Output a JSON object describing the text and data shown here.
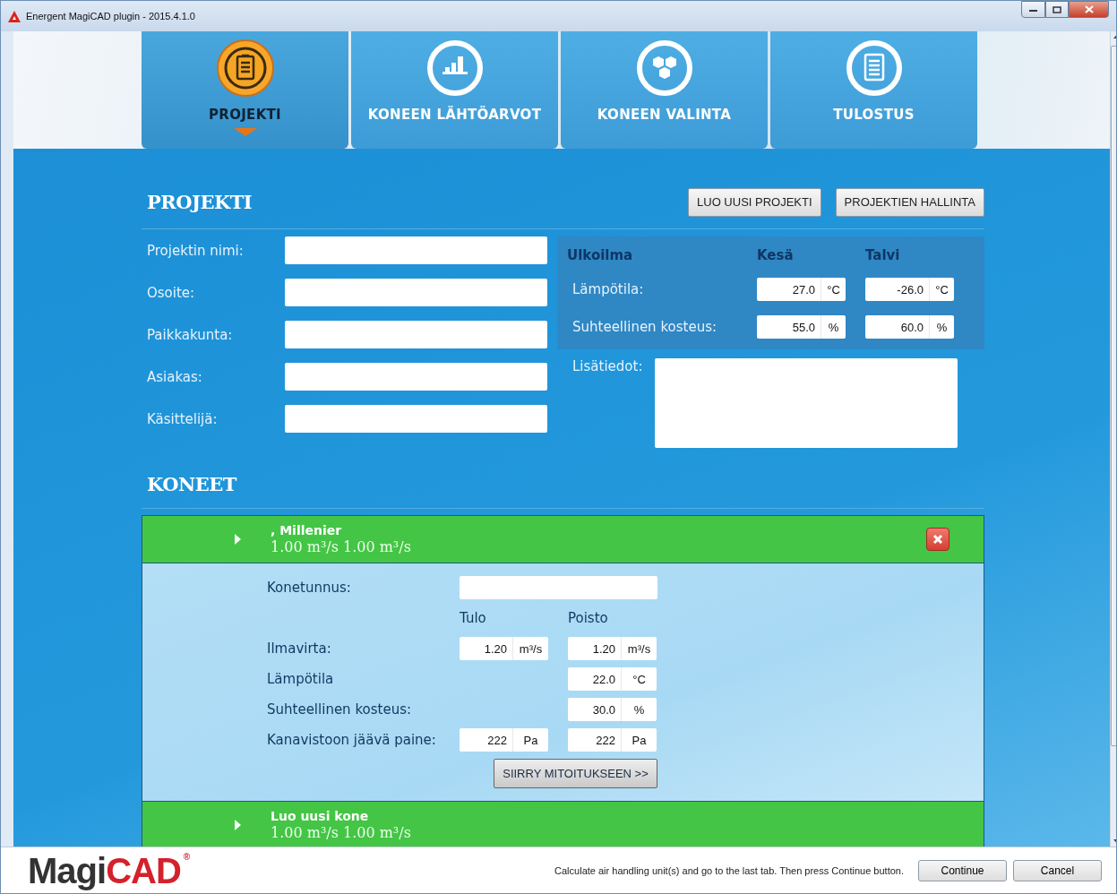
{
  "window": {
    "title": "Energent MagiCAD plugin - 2015.4.1.0"
  },
  "tabs": [
    {
      "label": "PROJEKTI",
      "selected": true
    },
    {
      "label": "KONEEN LÄHTÖARVOT",
      "selected": false
    },
    {
      "label": "KONEEN VALINTA",
      "selected": false
    },
    {
      "label": "TULOSTUS",
      "selected": false
    }
  ],
  "project": {
    "title": "PROJEKTI",
    "buttons": [
      "LUO UUSI PROJEKTI",
      "PROJEKTIEN HALLINTA"
    ],
    "fields": [
      {
        "label": "Projektin nimi:"
      },
      {
        "label": "Osoite:"
      },
      {
        "label": "Paikkakunta:"
      },
      {
        "label": "Asiakas:"
      },
      {
        "label": "Käsittelijä:"
      }
    ],
    "outdoor": {
      "heading": "Ulkoilma",
      "columns": [
        "Kesä",
        "Talvi"
      ],
      "rows": [
        {
          "label": "Lämpötila:",
          "values": [
            {
              "value": "27.0",
              "unit": "°C"
            },
            {
              "value": "-26.0",
              "unit": "°C"
            }
          ]
        },
        {
          "label": "Suhteellinen kosteus:",
          "values": [
            {
              "value": "55.0",
              "unit": "%"
            },
            {
              "value": "60.0",
              "unit": "%"
            }
          ]
        }
      ]
    },
    "notes": {
      "label": "Lisätiedot:"
    }
  },
  "machines": {
    "title": "KONEET",
    "items": [
      {
        "title": ", Millenier",
        "flow": "1.00 m³/s 1.00 m³/s",
        "removable": true,
        "expanded": true,
        "details": {
          "id_label": "Konetunnus:",
          "columns": [
            "Tulo",
            "Poisto"
          ],
          "rows": [
            {
              "label": "Ilmavirta:",
              "supply": {
                "value": "1.20",
                "unit": "m³/s"
              },
              "exhaust": {
                "value": "1.20",
                "unit": "m³/s"
              }
            },
            {
              "label": "Lämpötila",
              "exhaust": {
                "value": "22.0",
                "unit": "°C"
              }
            },
            {
              "label": "Suhteellinen kosteus:",
              "exhaust": {
                "value": "30.0",
                "unit": "%"
              }
            },
            {
              "label": "Kanavistoon jäävä paine:",
              "supply": {
                "value": "222",
                "unit": "Pa"
              },
              "exhaust": {
                "value": "222",
                "unit": "Pa"
              }
            }
          ],
          "button": "SIIRRY MITOITUKSEEN >>"
        }
      },
      {
        "title": "Luo uusi kone",
        "flow": "1.00 m³/s 1.00 m³/s",
        "removable": false,
        "expanded": false
      }
    ]
  },
  "footer": {
    "logo": {
      "part_1": "Magi",
      "part_2": "CAD",
      "mark": "®"
    },
    "message": "Calculate air handling unit(s) and go to the last tab. Then press Continue button.",
    "buttons": [
      "Continue",
      "Cancel"
    ]
  }
}
